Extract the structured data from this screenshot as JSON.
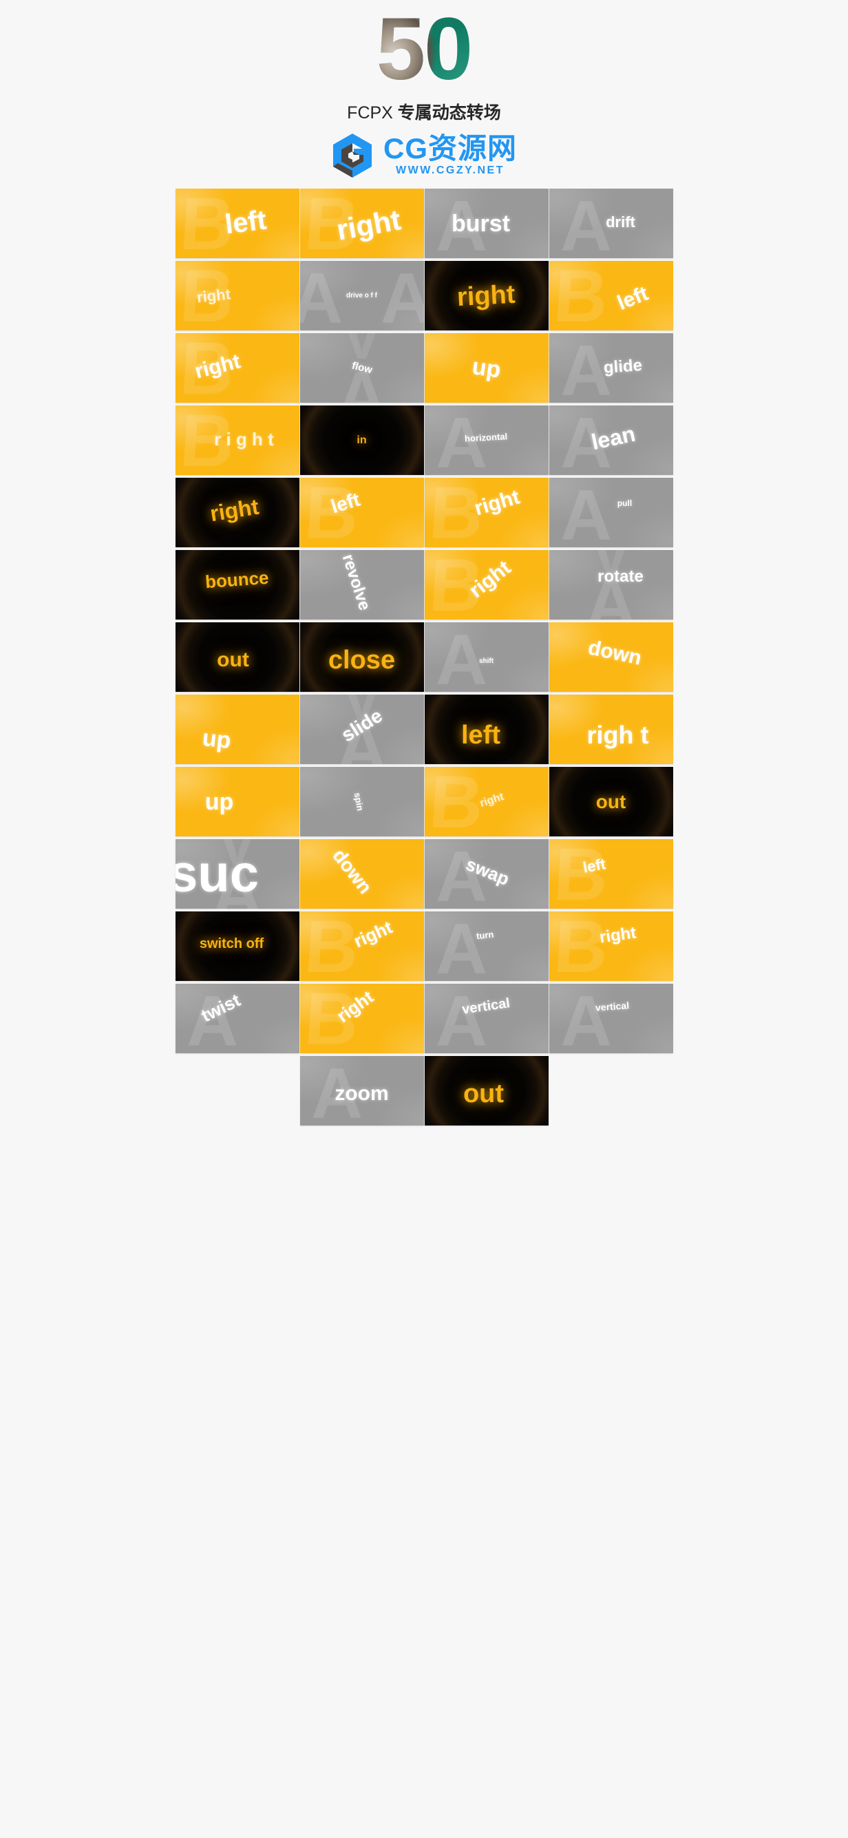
{
  "header": {
    "hero_number": "50",
    "subtitle_latin": "FCPX ",
    "subtitle_cn": "专属动态转场",
    "logo_text": "CG资源网",
    "logo_url": "WWW.CGZY.NET",
    "logo_color": "#2196f3",
    "hero_color_primary": "#157a63"
  },
  "palette": {
    "yellow": "#fbb713",
    "gray": "#999999",
    "black": "#000000",
    "page_bg": "#f7f7f7",
    "text_white": "#ffffff",
    "text_yellow": "#f9b212"
  },
  "grid": {
    "columns": 4,
    "rows": 13,
    "total_thumbnails": 50,
    "cells": [
      {
        "label": "left",
        "bg": "yellow",
        "text": "white",
        "size": 40,
        "rot": -7,
        "ghost": "B",
        "ox": 12,
        "oy": -2
      },
      {
        "label": "right",
        "bg": "yellow",
        "text": "white",
        "size": 42,
        "rot": -10,
        "ghost": "B",
        "ox": 10,
        "oy": 2
      },
      {
        "label": "burst",
        "bg": "gray",
        "text": "white",
        "size": 34,
        "rot": 0,
        "ghost": "A",
        "ox": -8,
        "oy": 0
      },
      {
        "label": "drift",
        "bg": "gray",
        "text": "white",
        "size": 22,
        "rot": 0,
        "ghost": "A",
        "ox": 14,
        "oy": -2
      },
      {
        "label": "right",
        "bg": "yellow",
        "text": "grayish",
        "size": 22,
        "rot": -6,
        "ghost": "B",
        "ox": -34,
        "oy": 0
      },
      {
        "label": "drive o f f",
        "bg": "gray",
        "text": "white",
        "size": 10,
        "rot": 0,
        "ghost": "AA",
        "ox": 0,
        "oy": 0
      },
      {
        "label": "right",
        "bg": "black",
        "text": "yellow",
        "size": 38,
        "rot": -3,
        "ghost": "",
        "ox": 0,
        "oy": 0
      },
      {
        "label": "left",
        "bg": "yellow",
        "text": "white",
        "size": 30,
        "rot": -22,
        "ghost": "B",
        "ox": 32,
        "oy": 4
      },
      {
        "label": "right",
        "bg": "yellow",
        "text": "white",
        "size": 30,
        "rot": -14,
        "ghost": "B",
        "ox": -28,
        "oy": -2
      },
      {
        "label": "flow",
        "bg": "gray",
        "text": "white",
        "size": 15,
        "rot": 14,
        "ghost": "VA",
        "ox": 0,
        "oy": 0
      },
      {
        "label": "up",
        "bg": "yellow",
        "text": "white",
        "size": 34,
        "rot": 8,
        "ghost": "",
        "ox": 0,
        "oy": 0
      },
      {
        "label": "glide",
        "bg": "gray",
        "text": "white",
        "size": 24,
        "rot": -4,
        "ghost": "A",
        "ox": 18,
        "oy": -2
      },
      {
        "label": "r i g h t",
        "bg": "yellow",
        "text": "grayish",
        "size": 26,
        "rot": 0,
        "ghost": "B",
        "ox": 10,
        "oy": -2
      },
      {
        "label": "in",
        "bg": "black",
        "text": "yellow",
        "size": 16,
        "rot": 0,
        "ghost": "",
        "ox": 0,
        "oy": 0
      },
      {
        "label": "horizontal",
        "bg": "gray",
        "text": "white",
        "size": 13,
        "rot": -3,
        "ghost": "A",
        "ox": 0,
        "oy": -4
      },
      {
        "label": "lean",
        "bg": "gray",
        "text": "white",
        "size": 32,
        "rot": -12,
        "ghost": "A",
        "ox": 4,
        "oy": -4
      },
      {
        "label": "right",
        "bg": "black",
        "text": "yellow",
        "size": 32,
        "rot": -9,
        "ghost": "",
        "ox": -4,
        "oy": -4
      },
      {
        "label": "left",
        "bg": "yellow",
        "text": "white",
        "size": 28,
        "rot": -17,
        "ghost": "B",
        "ox": -24,
        "oy": -14
      },
      {
        "label": "right",
        "bg": "yellow",
        "text": "white",
        "size": 30,
        "rot": -16,
        "ghost": "B",
        "ox": 16,
        "oy": -14
      },
      {
        "label": "pull",
        "bg": "gray",
        "text": "white",
        "size": 12,
        "rot": 0,
        "ghost": "A",
        "ox": 20,
        "oy": -14
      },
      {
        "label": "bounce",
        "bg": "black",
        "text": "yellow",
        "size": 26,
        "rot": -4,
        "ghost": "",
        "ox": 0,
        "oy": -8
      },
      {
        "label": "revolve",
        "bg": "gray",
        "text": "white",
        "size": 24,
        "rot": 72,
        "ghost": "",
        "ox": -8,
        "oy": -4
      },
      {
        "label": "right",
        "bg": "yellow",
        "text": "white",
        "size": 30,
        "rot": -38,
        "ghost": "B",
        "ox": 6,
        "oy": -8
      },
      {
        "label": "rotate",
        "bg": "gray",
        "text": "white",
        "size": 24,
        "rot": 0,
        "ghost": "V",
        "ox": 14,
        "oy": -12
      },
      {
        "label": "out",
        "bg": "black",
        "text": "yellow",
        "size": 30,
        "rot": 0,
        "ghost": "",
        "ox": -6,
        "oy": 4
      },
      {
        "label": "close",
        "bg": "black",
        "text": "yellow",
        "size": 38,
        "rot": 0,
        "ghost": "",
        "ox": 0,
        "oy": 4
      },
      {
        "label": "shift",
        "bg": "gray",
        "text": "white",
        "size": 10,
        "rot": 0,
        "ghost": "A",
        "ox": 0,
        "oy": 6
      },
      {
        "label": "down",
        "bg": "yellow",
        "text": "white",
        "size": 30,
        "rot": 12,
        "ghost": "",
        "ox": 6,
        "oy": -6
      },
      {
        "label": "up",
        "bg": "yellow",
        "text": "white",
        "size": 34,
        "rot": 6,
        "ghost": "",
        "ox": -30,
        "oy": 14
      },
      {
        "label": "slide",
        "bg": "gray",
        "text": "white",
        "size": 28,
        "rot": -32,
        "ghost": "V",
        "ox": 0,
        "oy": -6
      },
      {
        "label": "left",
        "bg": "black",
        "text": "yellow",
        "size": 38,
        "rot": 0,
        "ghost": "",
        "ox": -8,
        "oy": 8
      },
      {
        "label": "righ t",
        "bg": "yellow",
        "text": "white",
        "size": 36,
        "rot": 0,
        "ghost": "",
        "ox": 10,
        "oy": 8
      },
      {
        "label": "up",
        "bg": "yellow",
        "text": "white",
        "size": 34,
        "rot": 0,
        "ghost": "",
        "ox": -26,
        "oy": 0
      },
      {
        "label": "spin",
        "bg": "gray",
        "text": "white",
        "size": 13,
        "rot": 80,
        "ghost": "",
        "ox": -4,
        "oy": 0
      },
      {
        "label": "right",
        "bg": "yellow",
        "text": "grayish",
        "size": 16,
        "rot": -18,
        "ghost": "B",
        "ox": 8,
        "oy": -2
      },
      {
        "label": "out",
        "bg": "black",
        "text": "yellow",
        "size": 28,
        "rot": 0,
        "ghost": "",
        "ox": 0,
        "oy": 0
      },
      {
        "label": "suc",
        "bg": "gray",
        "text": "white",
        "size": 76,
        "rot": 0,
        "ghost": "V",
        "ox": -34,
        "oy": 0
      },
      {
        "label": "down",
        "bg": "yellow",
        "text": "white",
        "size": 28,
        "rot": 52,
        "ghost": "",
        "ox": -14,
        "oy": -4
      },
      {
        "label": "swap",
        "bg": "gray",
        "text": "white",
        "size": 26,
        "rot": 22,
        "ghost": "A",
        "ox": 2,
        "oy": -4
      },
      {
        "label": "left",
        "bg": "yellow",
        "text": "white",
        "size": 22,
        "rot": -10,
        "ghost": "B",
        "ox": -24,
        "oy": -12
      },
      {
        "label": "switch off",
        "bg": "black",
        "text": "yellow",
        "size": 20,
        "rot": 0,
        "ghost": "",
        "ox": -8,
        "oy": -4
      },
      {
        "label": "right",
        "bg": "yellow",
        "text": "white",
        "size": 26,
        "rot": -24,
        "ghost": "B",
        "ox": 16,
        "oy": -18
      },
      {
        "label": "turn",
        "bg": "gray",
        "text": "white",
        "size": 13,
        "rot": -6,
        "ghost": "A",
        "ox": -2,
        "oy": -16
      },
      {
        "label": "right",
        "bg": "yellow",
        "text": "white",
        "size": 24,
        "rot": -8,
        "ghost": "B",
        "ox": 10,
        "oy": -16
      },
      {
        "label": "twist",
        "bg": "gray",
        "text": "white",
        "size": 26,
        "rot": -26,
        "ghost": "A",
        "ox": -24,
        "oy": -16
      },
      {
        "label": "right",
        "bg": "yellow",
        "text": "white",
        "size": 26,
        "rot": -36,
        "ghost": "B",
        "ox": -10,
        "oy": -18
      },
      {
        "label": "vertical",
        "bg": "gray",
        "text": "white",
        "size": 20,
        "rot": -8,
        "ghost": "A",
        "ox": 0,
        "oy": -18
      },
      {
        "label": "vertical",
        "bg": "gray",
        "text": "white",
        "size": 14,
        "rot": -4,
        "ghost": "A",
        "ox": 2,
        "oy": -18
      },
      {
        "label": "",
        "bg": "empty",
        "text": "white",
        "size": 0,
        "rot": 0,
        "ghost": "",
        "ox": 0,
        "oy": 0
      },
      {
        "label": "zoom",
        "bg": "gray",
        "text": "white",
        "size": 30,
        "rot": 0,
        "ghost": "A",
        "ox": 0,
        "oy": 4
      },
      {
        "label": "out",
        "bg": "black",
        "text": "yellow",
        "size": 38,
        "rot": 0,
        "ghost": "",
        "ox": -4,
        "oy": 4
      },
      {
        "label": "",
        "bg": "empty",
        "text": "white",
        "size": 0,
        "rot": 0,
        "ghost": "",
        "ox": 0,
        "oy": 0
      }
    ]
  }
}
